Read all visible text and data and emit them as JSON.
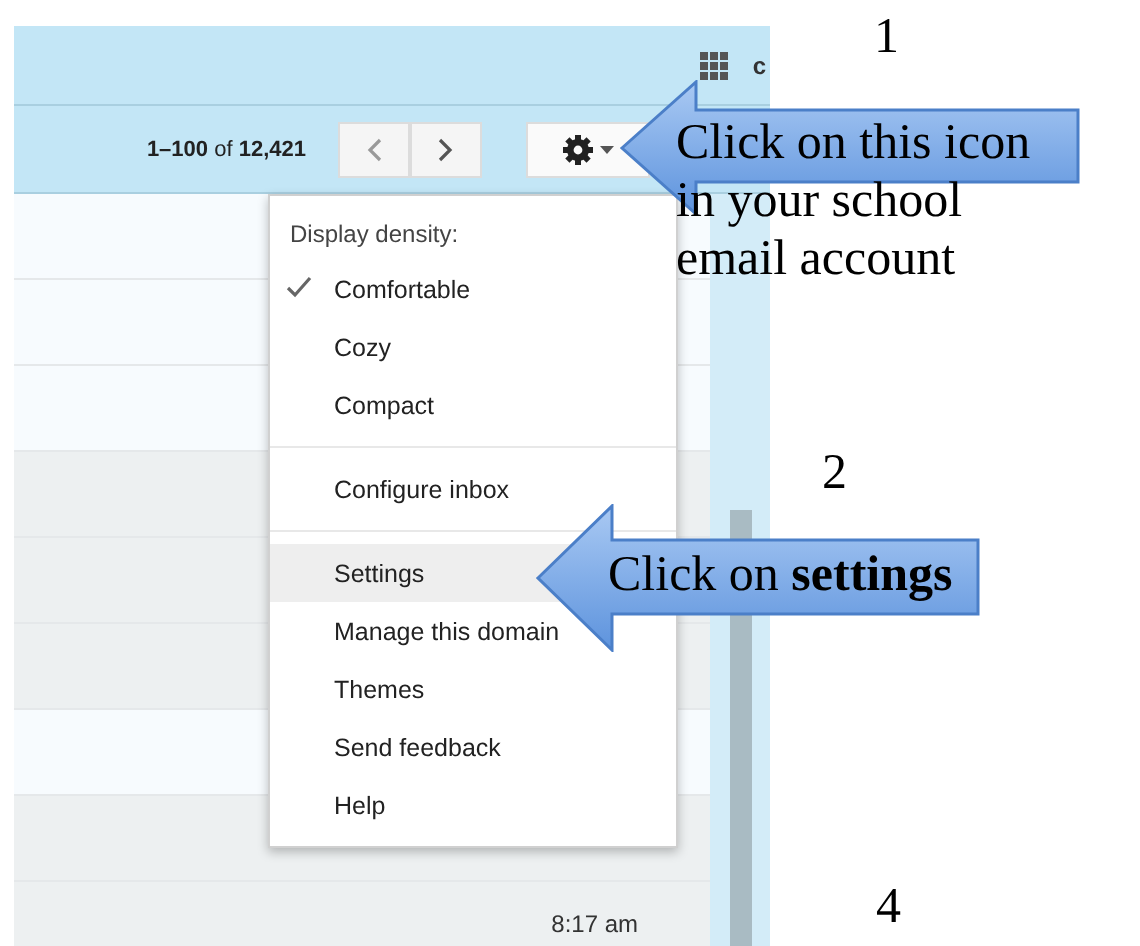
{
  "top_bar": {
    "account_initial": "c"
  },
  "toolbar": {
    "range": "1–100",
    "of": "of",
    "total": "12,421"
  },
  "menu": {
    "groups": [
      {
        "heading": "Display density:",
        "items": [
          {
            "label": "Comfortable",
            "checked": true
          },
          {
            "label": "Cozy",
            "checked": false
          },
          {
            "label": "Compact",
            "checked": false
          }
        ]
      },
      {
        "items": [
          {
            "label": "Configure inbox",
            "selected": false
          }
        ]
      },
      {
        "items": [
          {
            "label": "Settings",
            "selected": true
          },
          {
            "label": "Manage this domain",
            "selected": false
          },
          {
            "label": "Themes",
            "selected": false
          },
          {
            "label": "Send feedback",
            "selected": false
          },
          {
            "label": "Help",
            "selected": false
          }
        ]
      }
    ]
  },
  "rows": [
    {
      "unread": true
    },
    {
      "unread": true
    },
    {
      "unread": true
    },
    {
      "unread": false
    },
    {
      "unread": false
    },
    {
      "unread": false
    },
    {
      "unread": true
    },
    {
      "unread": false
    },
    {
      "unread": false,
      "time": "8:17 am"
    }
  ],
  "annotations": [
    {
      "kind": "number",
      "text": "1"
    },
    {
      "kind": "arrow",
      "lines": [
        "Click on this icon",
        "in your school",
        "email account"
      ]
    },
    {
      "kind": "number",
      "text": "2"
    },
    {
      "kind": "arrow",
      "lines": [
        "Click on **settings**"
      ]
    },
    {
      "kind": "number",
      "text": "4"
    }
  ]
}
